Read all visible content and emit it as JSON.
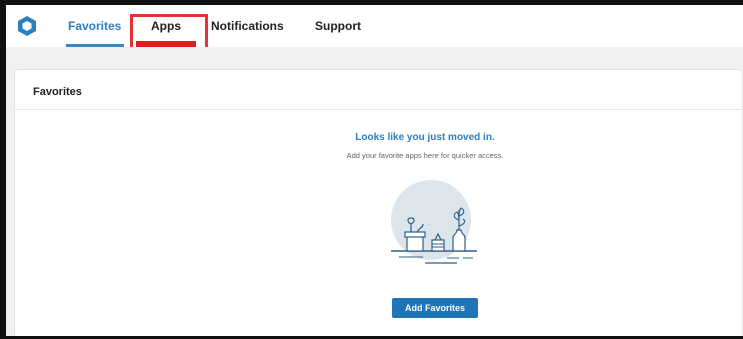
{
  "nav": {
    "logo_icon": "hexagon-logo-icon",
    "tabs": [
      {
        "label": "Favorites",
        "active": true
      },
      {
        "label": "Apps",
        "active": false,
        "highlighted": true
      },
      {
        "label": "Notifications",
        "active": false
      },
      {
        "label": "Support",
        "active": false
      }
    ]
  },
  "favorites_card": {
    "title": "Favorites",
    "empty_heading": "Looks like you just moved in.",
    "empty_subtext": "Add your favorite apps here for quicker access.",
    "illustration_icon": "plants-shelf-illustration",
    "button_label": "Add Favorites"
  },
  "colors": {
    "accent": "#2b7fbe",
    "button": "#1f73b7",
    "highlight": "#e53238"
  }
}
